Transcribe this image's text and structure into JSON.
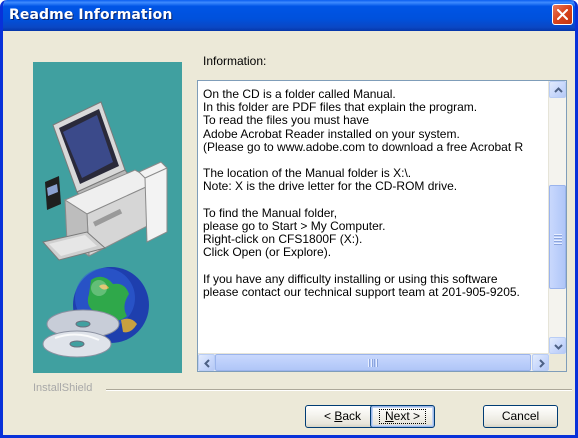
{
  "window": {
    "title": "Readme Information"
  },
  "info_label": "Information:",
  "readme_text": "On the CD is a folder called Manual.\nIn this folder are PDF files that explain the program.\nTo read the files you must have\nAdobe Acrobat Reader installed on your system.\n(Please go to www.adobe.com to download a free Acrobat R\n\nThe location of the Manual folder is X:\\.\nNote: X is the drive letter for the CD-ROM drive.\n\nTo find the Manual folder,\nplease go to Start > My Computer.\nRight-click on CFS1800F (X:).\nClick Open (or Explore).\n\nIf you have any difficulty installing or using this software\nplease contact our technical support team at 201-905-9205.",
  "branding": "InstallShield",
  "buttons": {
    "back": {
      "pre": "",
      "mnemonic": "B",
      "post": "ack"
    },
    "next": {
      "pre": "",
      "mnemonic": "N",
      "post": "ext >",
      "prefix": ""
    },
    "cancel": "Cancel",
    "back_prefix": "< "
  },
  "colors": {
    "titlebar": "#0055e6",
    "panel_bg": "#40a0a0",
    "window_bg": "#ece9d8",
    "close_button": "#d8431c"
  },
  "icons": {
    "close": "close-icon",
    "computer": "computer-illustration",
    "globe": "globe-illustration",
    "cds": "cd-disc-illustration"
  }
}
